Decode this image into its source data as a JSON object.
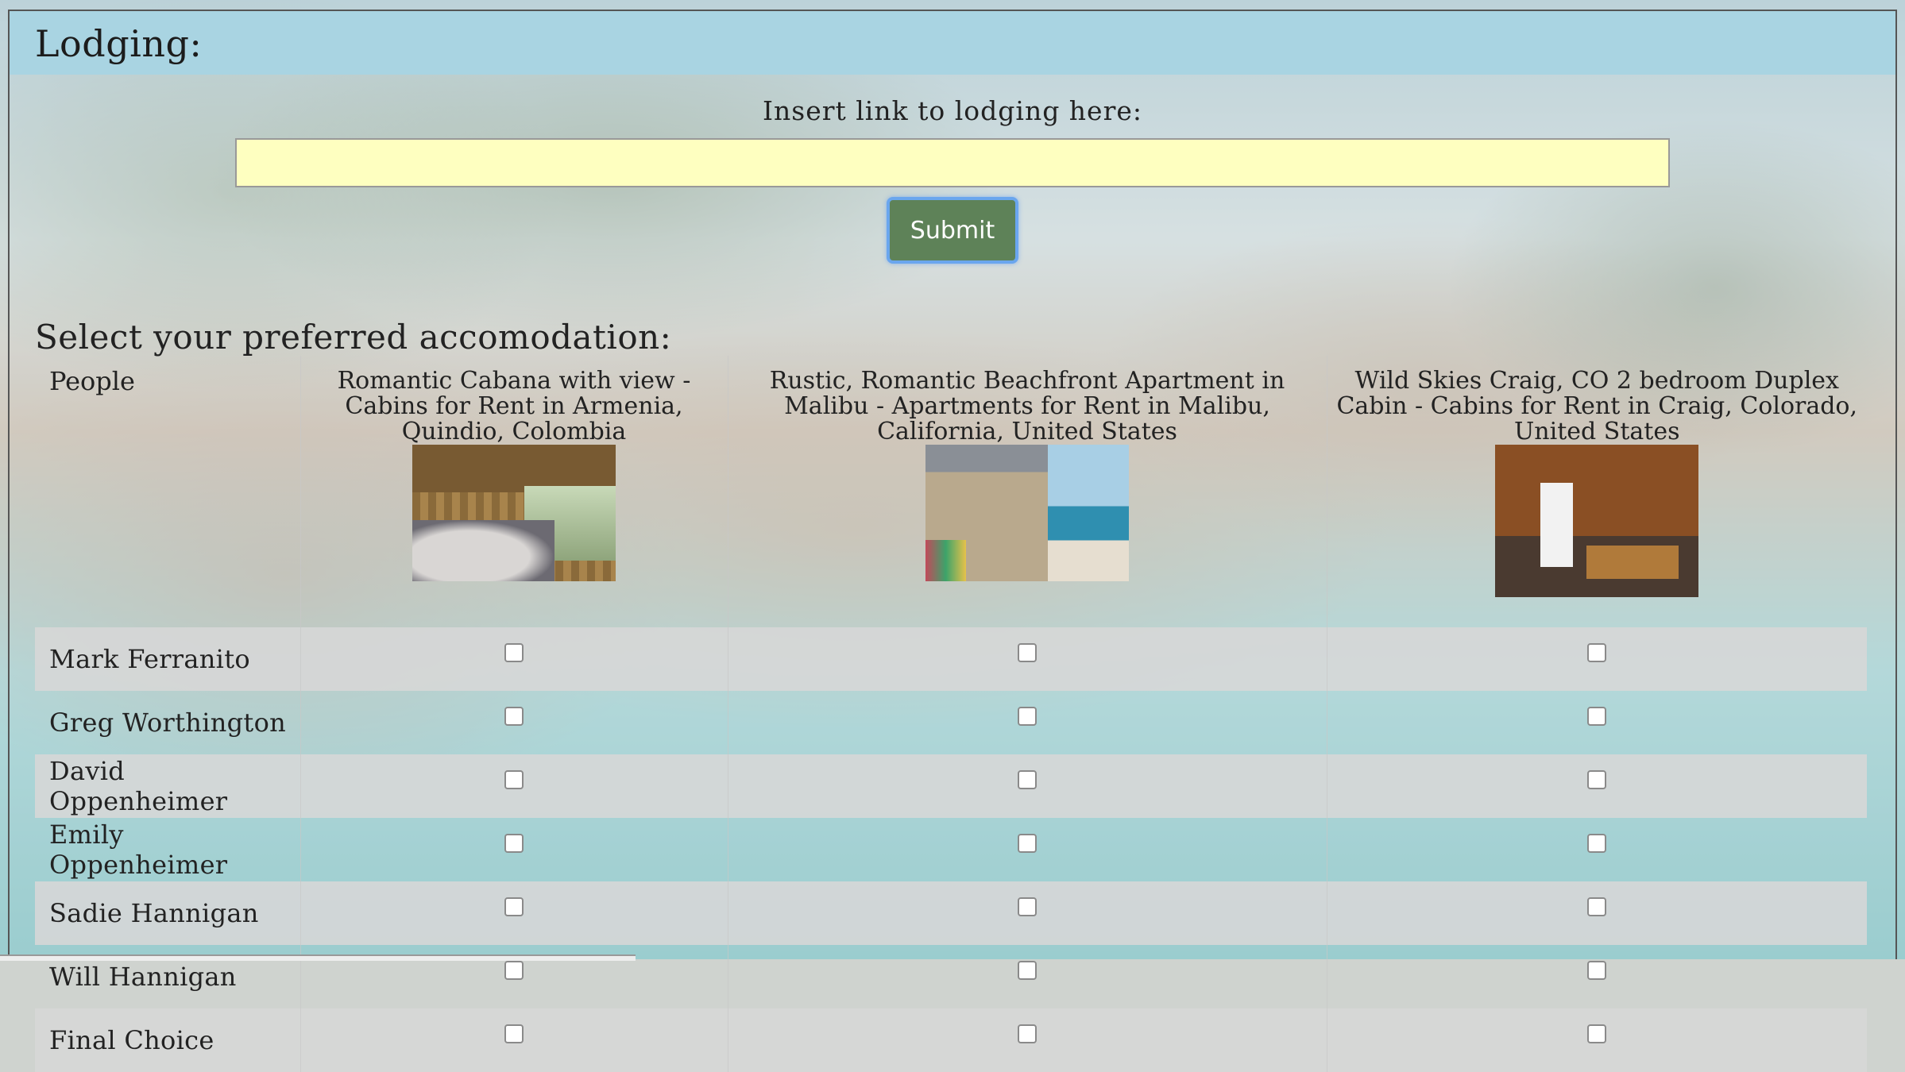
{
  "header": {
    "title": "Lodging:"
  },
  "link_form": {
    "label": "Insert link to lodging here:",
    "input_value": "",
    "submit_label": "Submit"
  },
  "accommodations": {
    "title": "Select your preferred accomodation:",
    "people_header": "People",
    "listings": [
      {
        "title": "Romantic Cabana with view - Cabins for Rent in Armenia, Quindio, Colombia"
      },
      {
        "title": "Rustic, Romantic Beachfront Apartment in Malibu - Apartments for Rent in Malibu, California, United States"
      },
      {
        "title": "Wild Skies Craig, CO 2 bedroom Duplex Cabin - Cabins for Rent in Craig, Colorado, United States"
      }
    ],
    "people": [
      "Mark Ferranito",
      "Greg Worthington",
      "David Oppenheimer",
      "Emily Oppenheimer",
      "Sadie Hannigan",
      "Will Hannigan",
      "Final Choice"
    ]
  }
}
